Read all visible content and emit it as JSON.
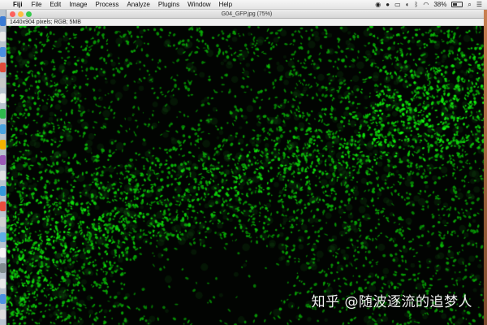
{
  "menubar": {
    "apple_glyph": "",
    "app_name": "Fiji",
    "items": [
      "File",
      "Edit",
      "Image",
      "Process",
      "Analyze",
      "Plugins",
      "Window",
      "Help"
    ],
    "status": {
      "battery_percent_label": "38%",
      "battery_level": 0.38
    },
    "status_icons": [
      "wechat-icon",
      "qq-icon",
      "screen-mirroring-icon",
      "notification-icon",
      "bluetooth-icon",
      "wifi-icon",
      "battery-icon",
      "search-icon",
      "menu-list-icon"
    ]
  },
  "window": {
    "title": "G04_GFP.jpg (75%)",
    "zoom_percent": 75,
    "info": "1440x904 pixels; RGB; 5MB"
  },
  "image": {
    "channel_color": "#2fd12f",
    "background_color": "#020402"
  },
  "watermark": {
    "text": "知乎 @随波逐流的追梦人"
  },
  "colors": {
    "close": "#fc605c",
    "minimize": "#fdbc40",
    "zoom": "#34c84a"
  },
  "dock": {
    "icon_colors": [
      "#3a7bd5",
      "#e8e8e8",
      "#4a90e2",
      "#e04a3a",
      "#c8c8c8",
      "#f0f0f0",
      "#2db84d",
      "#4aa3df",
      "#f4b400",
      "#9b59b6",
      "#e0e0e0",
      "#3498db",
      "#e74c3c",
      "#d0d0d0",
      "#5dade2",
      "#f5f5f5",
      "#7f8c8d",
      "#e8e8e8",
      "#4a90e2",
      "#dcdcdc"
    ]
  }
}
